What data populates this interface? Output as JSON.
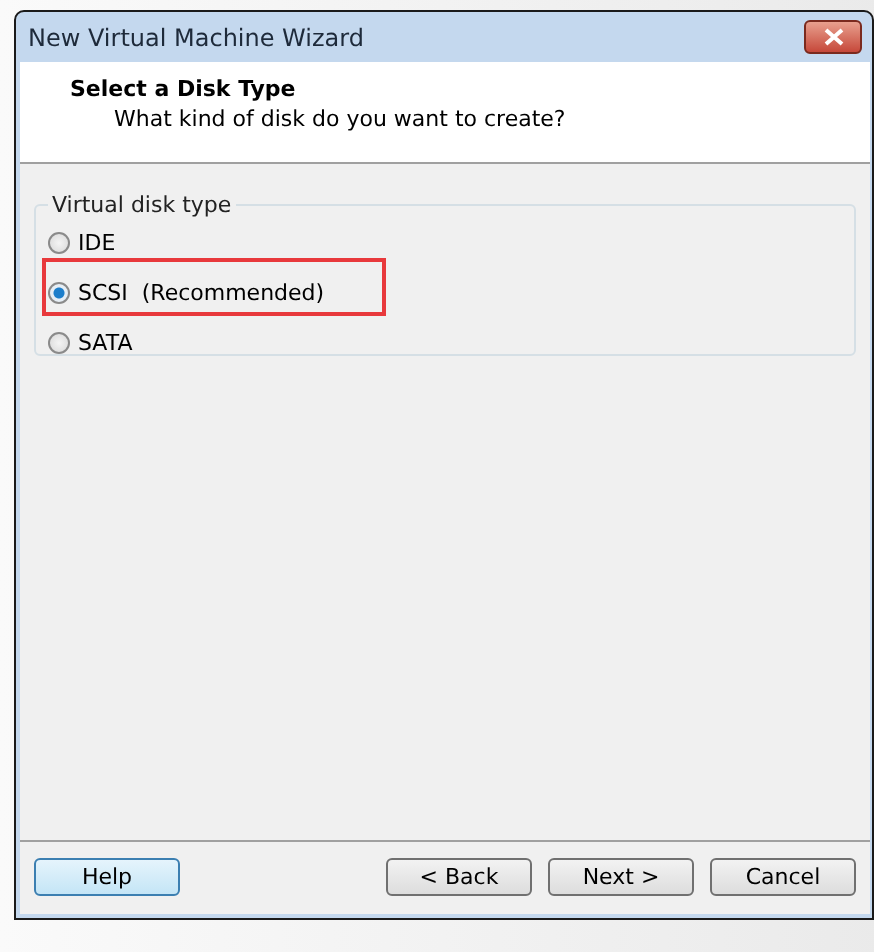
{
  "window": {
    "title": "New Virtual Machine Wizard"
  },
  "header": {
    "title": "Select a Disk Type",
    "subtitle": "What kind of disk do you want to create?"
  },
  "disk_type": {
    "label": "Virtual disk type",
    "options": [
      {
        "label": "IDE",
        "selected": false,
        "highlighted": false
      },
      {
        "label": "SCSI  (Recommended)",
        "selected": true,
        "highlighted": true
      },
      {
        "label": "SATA",
        "selected": false,
        "highlighted": false
      }
    ]
  },
  "buttons": [
    {
      "label": "Help",
      "kind": "help"
    },
    {
      "label": "< Back",
      "kind": "nav"
    },
    {
      "label": "Next >",
      "kind": "nav"
    },
    {
      "label": "Cancel",
      "kind": "nav"
    }
  ]
}
